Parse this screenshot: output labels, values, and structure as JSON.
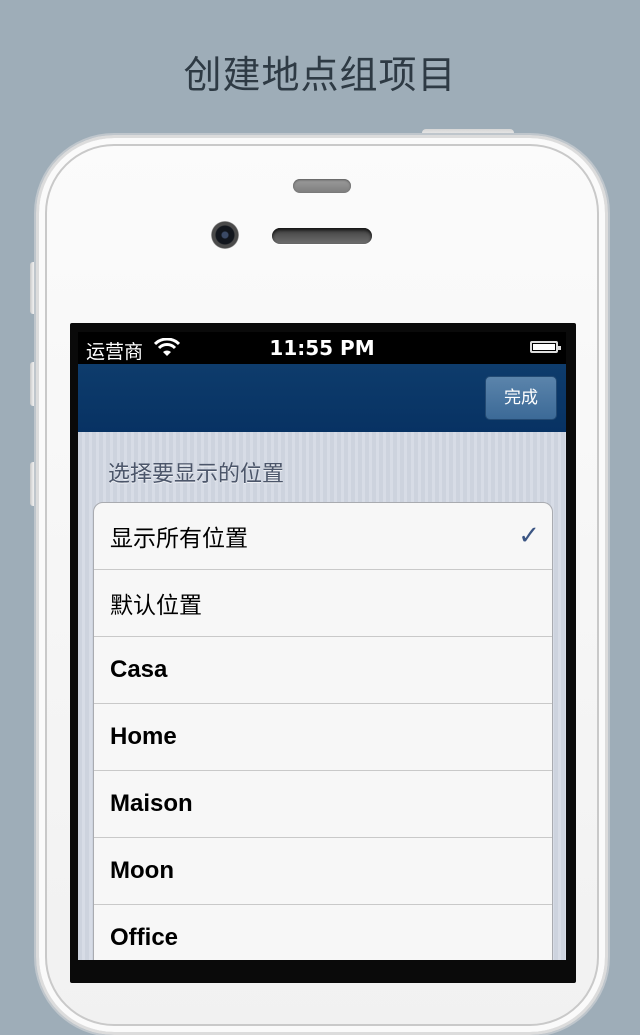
{
  "headline": "创建地点组项目",
  "status_bar": {
    "carrier": "运营商",
    "time": "11:55 PM"
  },
  "nav_bar": {
    "done_label": "完成"
  },
  "section": {
    "header": "选择要显示的位置"
  },
  "locations": [
    {
      "label": "显示所有位置",
      "checked": true
    },
    {
      "label": "默认位置",
      "checked": false
    },
    {
      "label": "Casa",
      "checked": false
    },
    {
      "label": "Home",
      "checked": false
    },
    {
      "label": "Maison",
      "checked": false
    },
    {
      "label": "Moon",
      "checked": false
    },
    {
      "label": "Office",
      "checked": false
    }
  ],
  "check_glyph": "✓",
  "colors": {
    "background": "#9eadb8",
    "nav_bar": "#0b3868",
    "checkmark": "#3b5583"
  }
}
